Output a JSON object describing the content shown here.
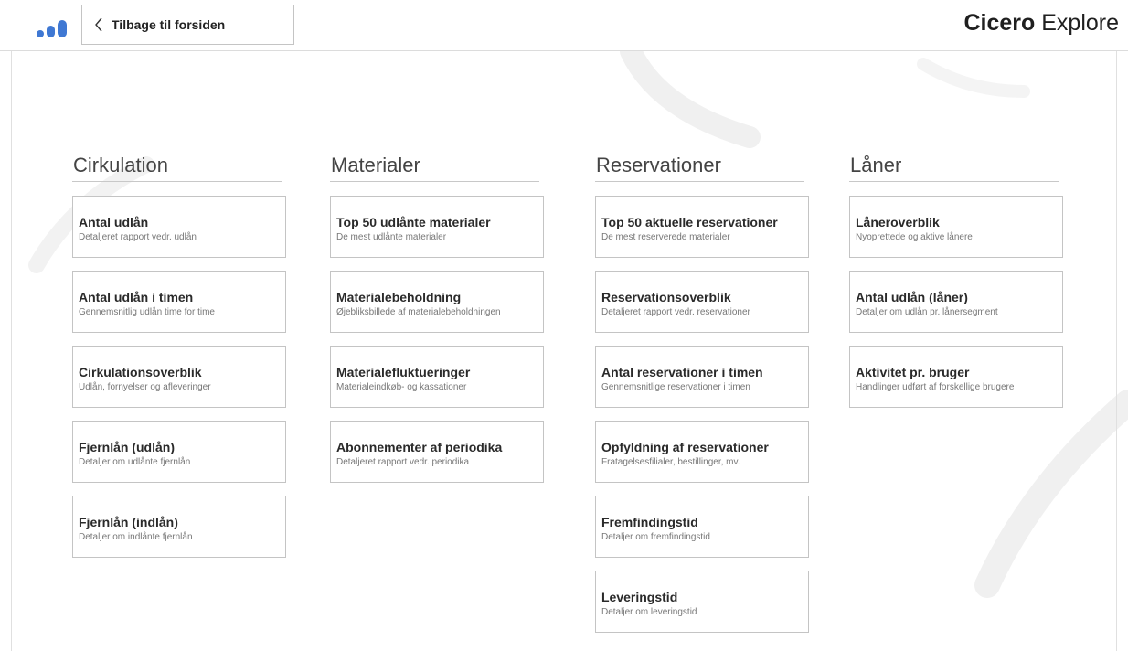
{
  "header": {
    "back_label": "Tilbage til forsiden",
    "brand_bold": "Cicero",
    "brand_light": "Explore",
    "accent_color": "#3f78d3",
    "logo_icon": "bar-chart-icon",
    "back_icon": "chevron-left-icon"
  },
  "columns": [
    {
      "title": "Cirkulation",
      "cards": [
        {
          "title": "Antal udlån",
          "desc": "Detaljeret rapport vedr. udlån"
        },
        {
          "title": "Antal udlån i timen",
          "desc": "Gennemsnitlig udlån time for time"
        },
        {
          "title": "Cirkulationsoverblik",
          "desc": "Udlån, fornyelser og afleveringer"
        },
        {
          "title": "Fjernlån (udlån)",
          "desc": "Detaljer om udlånte fjernlån"
        },
        {
          "title": "Fjernlån (indlån)",
          "desc": "Detaljer om indlånte fjernlån"
        }
      ]
    },
    {
      "title": "Materialer",
      "cards": [
        {
          "title": "Top 50 udlånte materialer",
          "desc": "De mest udlånte materialer"
        },
        {
          "title": "Materialebeholdning",
          "desc": "Øjebliksbillede af materialebeholdningen"
        },
        {
          "title": "Materialefluktueringer",
          "desc": "Materialeindkøb- og kassationer"
        },
        {
          "title": "Abonnementer af periodika",
          "desc": "Detaljeret rapport vedr. periodika"
        }
      ]
    },
    {
      "title": "Reservationer",
      "cards": [
        {
          "title": "Top 50 aktuelle reservationer",
          "desc": "De mest reserverede materialer"
        },
        {
          "title": "Reservationsoverblik",
          "desc": "Detaljeret rapport vedr. reservationer"
        },
        {
          "title": "Antal reservationer i timen",
          "desc": "Gennemsnitlige reservationer i timen"
        },
        {
          "title": "Opfyldning af reservationer",
          "desc": "Fratagelsesfilialer, bestillinger, mv."
        },
        {
          "title": "Fremfindingstid",
          "desc": "Detaljer om fremfindingstid"
        },
        {
          "title": "Leveringstid",
          "desc": "Detaljer om leveringstid"
        }
      ]
    },
    {
      "title": "Låner",
      "cards": [
        {
          "title": "Låneroverblik",
          "desc": "Nyoprettede og aktive lånere"
        },
        {
          "title": "Antal udlån (låner)",
          "desc": "Detaljer om udlån pr. lånersegment"
        },
        {
          "title": "Aktivitet pr. bruger",
          "desc": "Handlinger udført af forskellige brugere"
        }
      ]
    }
  ]
}
